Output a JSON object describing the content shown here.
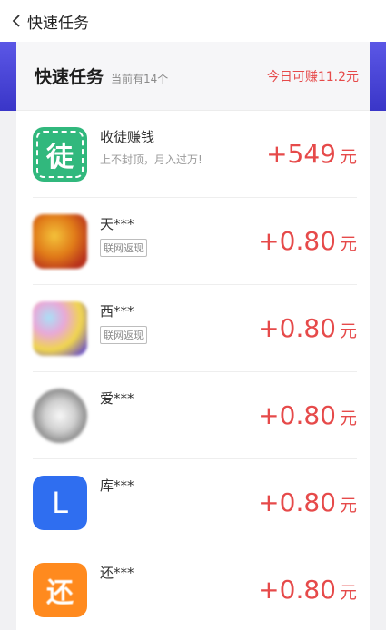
{
  "nav": {
    "title": "快速任务"
  },
  "panel": {
    "title": "快速任务",
    "count": "当前有14个",
    "earn_today": "今日可赚11.2元"
  },
  "tasks": [
    {
      "name": "收徒赚钱",
      "subtitle": "上不封顶，月入过万!",
      "reward": "+549",
      "unit": "元",
      "icon": "tu-icon",
      "icon_char": "徒"
    },
    {
      "name": "天***",
      "tag": "联网返现",
      "reward": "+0.80",
      "unit": "元",
      "icon": "app-icon-tian"
    },
    {
      "name": "西***",
      "tag": "联网返现",
      "reward": "+0.80",
      "unit": "元",
      "icon": "app-icon-xi"
    },
    {
      "name": "爱***",
      "reward": "+0.80",
      "unit": "元",
      "icon": "app-icon-ai"
    },
    {
      "name": "库***",
      "reward": "+0.80",
      "unit": "元",
      "icon": "app-icon-ku",
      "icon_char": "L"
    },
    {
      "name": "还***",
      "reward": "+0.80",
      "unit": "元",
      "icon": "app-icon-huan",
      "icon_char": "还"
    }
  ],
  "colors": {
    "accent_red": "#e64a4a",
    "header_purple": "#4a46d6",
    "tu_green": "#31b87d"
  }
}
